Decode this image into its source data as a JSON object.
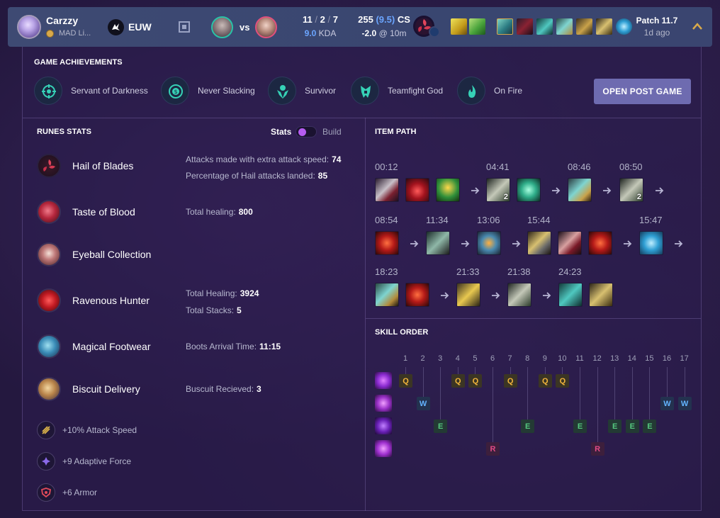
{
  "header": {
    "summoner_name": "Carzzy",
    "team_tag": "MAD Li...",
    "region": "EUW",
    "vs_label": "vs",
    "kills": "11",
    "deaths": "2",
    "assists": "7",
    "kda_ratio": "9.0",
    "kda_label": "KDA",
    "cs": "255",
    "cs_per_min": "(9.5)",
    "cs_label": "CS",
    "cs_diff": "-2.0",
    "cs_diff_at": "@ 10m",
    "patch": "Patch 11.7",
    "age": "1d ago",
    "colors": {
      "ally_ring": "#29c2a7",
      "enemy_ring": "#e0507c",
      "accent_blue": "#6ba5ff"
    }
  },
  "achievements": {
    "title": "GAME ACHIEVEMENTS",
    "items": [
      {
        "label": "Servant of Darkness",
        "icon": "crosshair-icon"
      },
      {
        "label": "Never Slacking",
        "icon": "coin-icon"
      },
      {
        "label": "Survivor",
        "icon": "survivor-icon"
      },
      {
        "label": "Teamfight God",
        "icon": "teamfight-icon"
      },
      {
        "label": "On Fire",
        "icon": "flame-icon"
      }
    ],
    "button": "OPEN POST GAME"
  },
  "runes": {
    "title": "RUNES STATS",
    "toggle_left": "Stats",
    "toggle_right": "Build",
    "list": [
      {
        "name": "Hail of Blades",
        "stats": [
          {
            "label": "Attacks made with extra attack speed:",
            "value": "74"
          },
          {
            "label": "Percentage of Hail attacks landed:",
            "value": "85"
          }
        ]
      },
      {
        "name": "Taste of Blood",
        "stats": [
          {
            "label": "Total healing:",
            "value": "800"
          }
        ]
      },
      {
        "name": "Eyeball Collection",
        "stats": []
      },
      {
        "name": "Ravenous Hunter",
        "stats": [
          {
            "label": "Total Healing:",
            "value": "3924"
          },
          {
            "label": "Total Stacks:",
            "value": "5"
          }
        ]
      },
      {
        "name": "Magical Footwear",
        "stats": [
          {
            "label": "Boots Arrival Time:",
            "value": "11:15"
          }
        ]
      },
      {
        "name": "Biscuit Delivery",
        "stats": [
          {
            "label": "Buscuit Recieved:",
            "value": "3"
          }
        ]
      }
    ],
    "shards": [
      {
        "label": "+10% Attack Speed",
        "icon": "attack-speed-shard-icon"
      },
      {
        "label": "+9 Adaptive Force",
        "icon": "adaptive-force-shard-icon"
      },
      {
        "label": "+6 Armor",
        "icon": "armor-shard-icon"
      }
    ]
  },
  "item_path": {
    "title": "ITEM PATH",
    "times": [
      "00:12",
      "04:41",
      "08:46",
      "08:50",
      "08:54",
      "11:34",
      "13:06",
      "15:44",
      "15:47",
      "18:23",
      "21:33",
      "21:38",
      "24:23"
    ],
    "stack_counts": [
      "2",
      "2"
    ]
  },
  "skill_order": {
    "title": "SKILL ORDER",
    "levels": [
      "1",
      "2",
      "3",
      "4",
      "5",
      "6",
      "7",
      "8",
      "9",
      "10",
      "11",
      "12",
      "13",
      "14",
      "15",
      "16",
      "17"
    ],
    "sequence": [
      "Q",
      "W",
      "E",
      "Q",
      "Q",
      "R",
      "Q",
      "E",
      "Q",
      "Q",
      "E",
      "R",
      "E",
      "E",
      "E",
      "W",
      "W"
    ]
  }
}
